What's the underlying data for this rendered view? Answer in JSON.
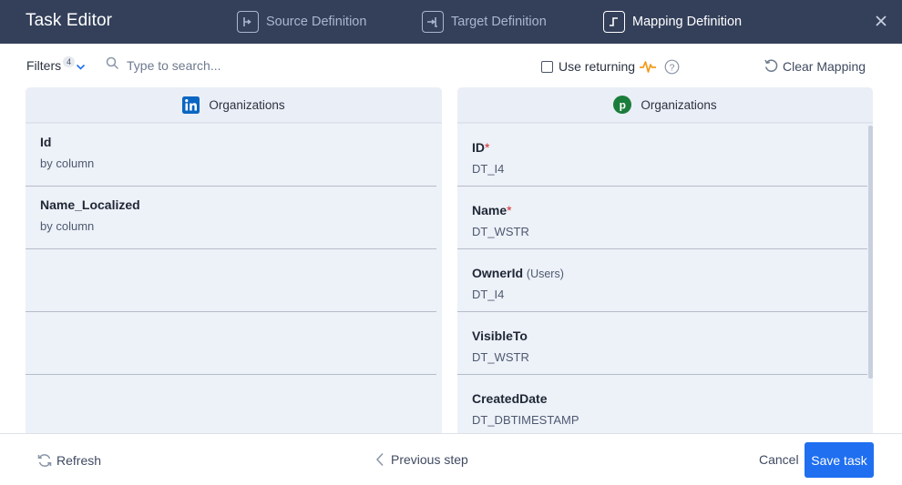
{
  "header": {
    "title": "Task Editor",
    "steps": [
      {
        "label": "Source Definition",
        "icon": "source-definition-icon",
        "active": false
      },
      {
        "label": "Target Definition",
        "icon": "target-definition-icon",
        "active": false
      },
      {
        "label": "Mapping Definition",
        "icon": "mapping-definition-icon",
        "active": true
      }
    ]
  },
  "toolbar": {
    "filters_label": "Filters",
    "filters_count": "4",
    "search_placeholder": "Type to search...",
    "use_returning_label": "Use returning",
    "use_returning_checked": false,
    "clear_mapping_label": "Clear Mapping"
  },
  "source": {
    "title": "Organizations",
    "connector_icon": "linkedin-icon",
    "fields": [
      {
        "name": "Id",
        "mapping": "by column"
      },
      {
        "name": "Name_Localized",
        "mapping": "by column"
      },
      {
        "name": "",
        "mapping": ""
      },
      {
        "name": "",
        "mapping": ""
      },
      {
        "name": "",
        "mapping": ""
      }
    ]
  },
  "target": {
    "title": "Organizations",
    "connector_icon": "pipedrive-icon",
    "fields": [
      {
        "name": "ID",
        "required": "*",
        "ref": "",
        "type": "DT_I4"
      },
      {
        "name": "Name",
        "required": "*",
        "ref": "",
        "type": "DT_WSTR"
      },
      {
        "name": "OwnerId",
        "required": "",
        "ref": "(Users)",
        "type": "DT_I4"
      },
      {
        "name": "VisibleTo",
        "required": "",
        "ref": "",
        "type": "DT_WSTR"
      },
      {
        "name": "CreatedDate",
        "required": "",
        "ref": "",
        "type": "DT_DBTIMESTAMP"
      }
    ]
  },
  "footer": {
    "refresh_label": "Refresh",
    "previous_label": "Previous step",
    "cancel_label": "Cancel",
    "save_label": "Save task"
  },
  "colors": {
    "header_bg": "#34405a",
    "accent": "#1f6ff0",
    "panel_bg": "#edf1f8",
    "required": "#d42a2a",
    "returning_icon": "#f39a1b",
    "linkedin": "#0a66c2",
    "pipedrive": "#1a7d3c"
  }
}
